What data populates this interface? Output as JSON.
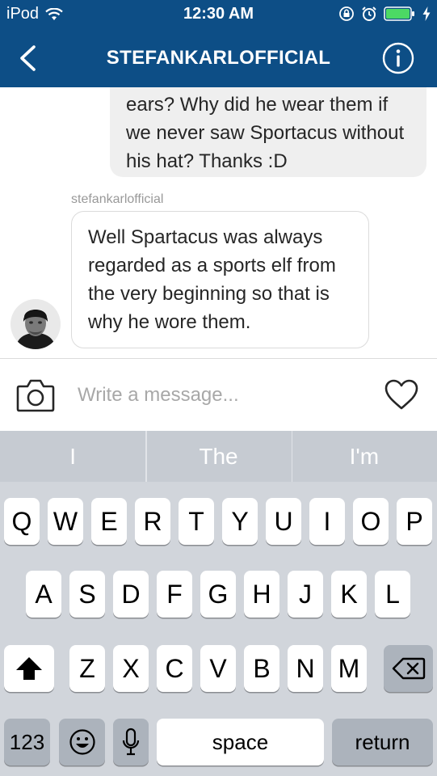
{
  "status_bar": {
    "carrier": "iPod",
    "time": "12:30 AM"
  },
  "header": {
    "title": "STEFANKARLOFFICIAL"
  },
  "conversation": {
    "outgoing_text": "ears? Why did he wear them if we never saw Sportacus without his hat? Thanks :D",
    "sender_name": "stefankarlofficial",
    "incoming_text": "Well Spartacus was always regarded as a sports elf from the very beginning so that is why he wore them."
  },
  "composer": {
    "placeholder": "Write a message..."
  },
  "keyboard": {
    "predictions": [
      "I",
      "The",
      "I'm"
    ],
    "row1": [
      "Q",
      "W",
      "E",
      "R",
      "T",
      "Y",
      "U",
      "I",
      "O",
      "P"
    ],
    "row2": [
      "A",
      "S",
      "D",
      "F",
      "G",
      "H",
      "J",
      "K",
      "L"
    ],
    "row3": [
      "Z",
      "X",
      "C",
      "V",
      "B",
      "N",
      "M"
    ],
    "numbers_label": "123",
    "space_label": "space",
    "return_label": "return"
  },
  "colors": {
    "header_bg": "#0d4e86",
    "bubble_out_bg": "#efefef",
    "keyboard_bg": "#d1d5db",
    "battery_fill": "#4cd964"
  },
  "icons": [
    "wifi-icon",
    "orientation-lock-icon",
    "alarm-icon",
    "battery-icon",
    "charging-icon",
    "back-chevron-icon",
    "info-icon",
    "camera-icon",
    "heart-icon",
    "shift-icon",
    "delete-icon",
    "emoji-icon",
    "microphone-icon"
  ]
}
